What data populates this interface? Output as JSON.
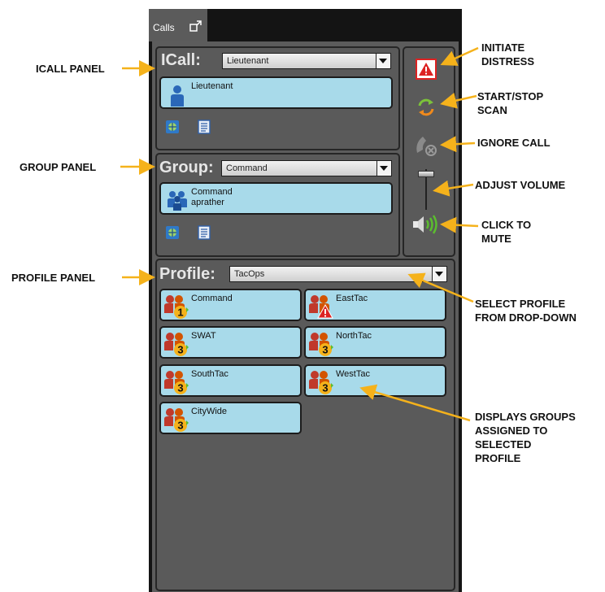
{
  "tab": {
    "label": "Calls",
    "icon": "popout-icon"
  },
  "icall": {
    "heading": "ICall:",
    "dropdown_value": "Lieutenant",
    "card_label": "Lieutenant",
    "icons": [
      "map-icon",
      "notes-icon"
    ]
  },
  "group": {
    "heading": "Group:",
    "dropdown_value": "Command",
    "card_line1": "Command",
    "card_line2": "aprather",
    "icons": [
      "map-icon",
      "notes-icon"
    ]
  },
  "profile": {
    "heading": "Profile:",
    "dropdown_value": "TacOps",
    "groups": [
      {
        "label": "Command",
        "badge": "1"
      },
      {
        "label": "EastTac",
        "badge": "!"
      },
      {
        "label": "SWAT",
        "badge": "3"
      },
      {
        "label": "NorthTac",
        "badge": "3"
      },
      {
        "label": "SouthTac",
        "badge": "3"
      },
      {
        "label": "WestTac",
        "badge": "3"
      },
      {
        "label": "CityWide",
        "badge": "3"
      }
    ]
  },
  "side_controls": [
    "distress-icon",
    "scan-icon",
    "ignore-call-icon",
    "volume-slider",
    "speaker-icon"
  ],
  "annotations": {
    "icall_panel": "ICALL PANEL",
    "group_panel": "GROUP PANEL",
    "profile_panel": "PROFILE PANEL",
    "initiate_distress_1": "INITIATE",
    "initiate_distress_2": "DISTRESS",
    "scan_1": "START/STOP",
    "scan_2": "SCAN",
    "ignore_call": "IGNORE CALL",
    "adjust_volume": "ADJUST VOLUME",
    "mute_1": "CLICK TO",
    "mute_2": "MUTE",
    "select_profile_1": "SELECT PROFILE",
    "select_profile_2": "FROM DROP-DOWN",
    "displays_1": "DISPLAYS GROUPS",
    "displays_2": "ASSIGNED TO",
    "displays_3": "SELECTED",
    "displays_4": "PROFILE"
  },
  "colors": {
    "card": "#a8daea",
    "panel": "#5a5a5a",
    "arrow": "#f5b21b",
    "frame": "#141414"
  }
}
